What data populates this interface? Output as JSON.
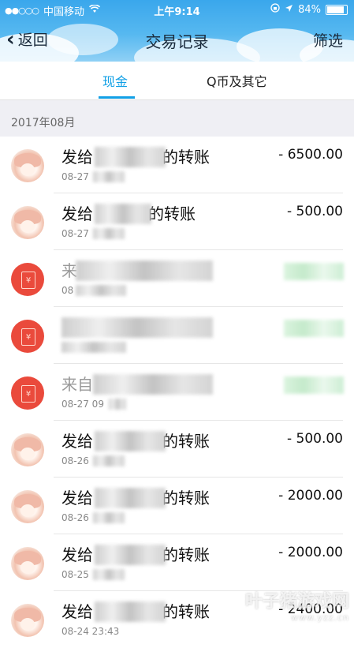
{
  "status_bar": {
    "carrier_dots": "●●○○○",
    "carrier": "中国移动",
    "time": "上午9:14",
    "battery": "84%",
    "battery_level": 0.84
  },
  "nav": {
    "back_label": "返回",
    "title": "交易记录",
    "filter_label": "筛选"
  },
  "tabs": [
    {
      "label": "现金",
      "active": true
    },
    {
      "label": "Q币及其它",
      "active": false
    }
  ],
  "month_header": "2017年08月",
  "transactions": [
    {
      "icon": "avatar",
      "title_prefix": "发给",
      "title_suffix": "的转账",
      "date": "08-27",
      "amount": "- 6500.00"
    },
    {
      "icon": "avatar",
      "title_prefix": "发给",
      "title_suffix": "的转账",
      "date": "08-27",
      "amount": "- 500.00"
    },
    {
      "icon": "red-packet",
      "title_prefix": "来",
      "title_suffix": "",
      "date": "08",
      "amount": ""
    },
    {
      "icon": "red-packet",
      "title_prefix": "",
      "title_suffix": "",
      "date": "",
      "amount": ""
    },
    {
      "icon": "red-packet",
      "title_prefix": "来自",
      "title_suffix": "",
      "date": "08-27 09",
      "amount": ""
    },
    {
      "icon": "avatar",
      "title_prefix": "发给",
      "title_suffix": "的转账",
      "date": "08-26",
      "amount": "- 500.00"
    },
    {
      "icon": "avatar",
      "title_prefix": "发给",
      "title_suffix": "的转账",
      "date": "08-26",
      "amount": "- 2000.00"
    },
    {
      "icon": "avatar",
      "title_prefix": "发给",
      "title_suffix": "的转账",
      "date": "08-25",
      "amount": "- 2000.00"
    },
    {
      "icon": "avatar",
      "title_prefix": "发给",
      "title_suffix": "的转账",
      "date": "08-24 23:43",
      "amount": "- 2400.00"
    }
  ],
  "watermark": {
    "text": "叶子猪游戏网",
    "url": "www.yzz.cn"
  },
  "colors": {
    "accent": "#12a0e6",
    "red_packet": "#ea4a3c"
  }
}
